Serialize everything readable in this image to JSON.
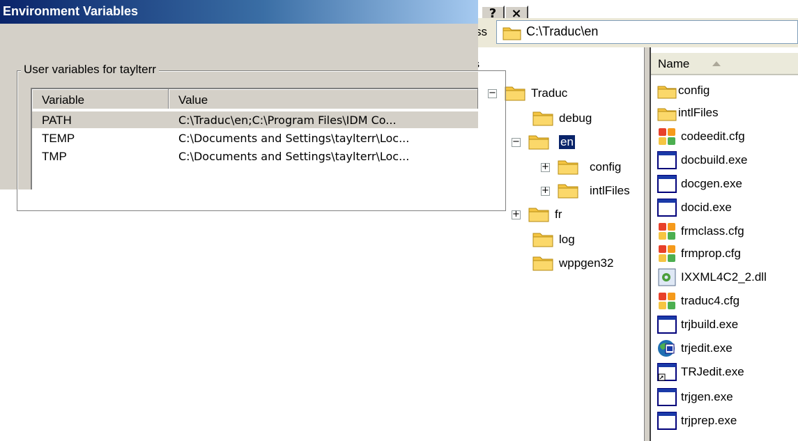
{
  "explorer": {
    "title_buttons": [
      "?",
      "×"
    ],
    "address": {
      "label": "ss",
      "value": "C:\\Traduc\\en"
    },
    "tree_header_tail": "s",
    "tree": [
      {
        "label": "Traduc",
        "expander": "−",
        "depth": 0,
        "selected": false
      },
      {
        "label": "debug",
        "expander": "",
        "depth": 1,
        "selected": false
      },
      {
        "label": "en",
        "expander": "−",
        "depth": 1,
        "selected": true
      },
      {
        "label": "config",
        "expander": "+",
        "depth": 2,
        "selected": false
      },
      {
        "label": "intlFiles",
        "expander": "+",
        "depth": 2,
        "selected": false
      },
      {
        "label": "fr",
        "expander": "+",
        "depth": 1,
        "selected": false
      },
      {
        "label": "log",
        "expander": "",
        "depth": 1,
        "selected": false
      },
      {
        "label": "wppgen32",
        "expander": "",
        "depth": 1,
        "selected": false
      }
    ],
    "list_header": {
      "name": "Name"
    },
    "files": [
      {
        "name": "config",
        "icon": "folder-icon"
      },
      {
        "name": "intlFiles",
        "icon": "folder-icon"
      },
      {
        "name": "codeedit.cfg",
        "icon": "cfg-file-icon"
      },
      {
        "name": "docbuild.exe",
        "icon": "exe-window-icon"
      },
      {
        "name": "docgen.exe",
        "icon": "exe-window-icon"
      },
      {
        "name": "docid.exe",
        "icon": "exe-window-icon"
      },
      {
        "name": "frmclass.cfg",
        "icon": "cfg-file-icon"
      },
      {
        "name": "frmprop.cfg",
        "icon": "cfg-file-icon"
      },
      {
        "name": "IXXML4C2_2.dll",
        "icon": "dll-file-icon"
      },
      {
        "name": "traduc4.cfg",
        "icon": "cfg-file-icon"
      },
      {
        "name": "trjbuild.exe",
        "icon": "exe-window-icon"
      },
      {
        "name": "trjedit.exe",
        "icon": "globe-app-icon"
      },
      {
        "name": "TRJedit.exe",
        "icon": "shortcut-exe-icon"
      },
      {
        "name": "trjgen.exe",
        "icon": "exe-window-icon"
      },
      {
        "name": "trjprep.exe",
        "icon": "exe-window-icon"
      }
    ]
  },
  "env_dialog": {
    "title": "Environment Variables",
    "group_label": "User variables for taylterr",
    "columns": [
      "Variable",
      "Value"
    ],
    "rows": [
      {
        "variable": "PATH",
        "value": "C:\\Traduc\\en;C:\\Program Files\\IDM Co...",
        "selected": true
      },
      {
        "variable": "TEMP",
        "value": "C:\\Documents and Settings\\taylterr\\Loc...",
        "selected": false
      },
      {
        "variable": "TMP",
        "value": "C:\\Documents and Settings\\taylterr\\Loc...",
        "selected": false
      }
    ]
  },
  "colors": {
    "titlebar_start": "#0a246a",
    "titlebar_end": "#a6caf0",
    "dialog_face": "#d4d0c8",
    "selection": "#0a246a",
    "folder": "#f5c542"
  }
}
